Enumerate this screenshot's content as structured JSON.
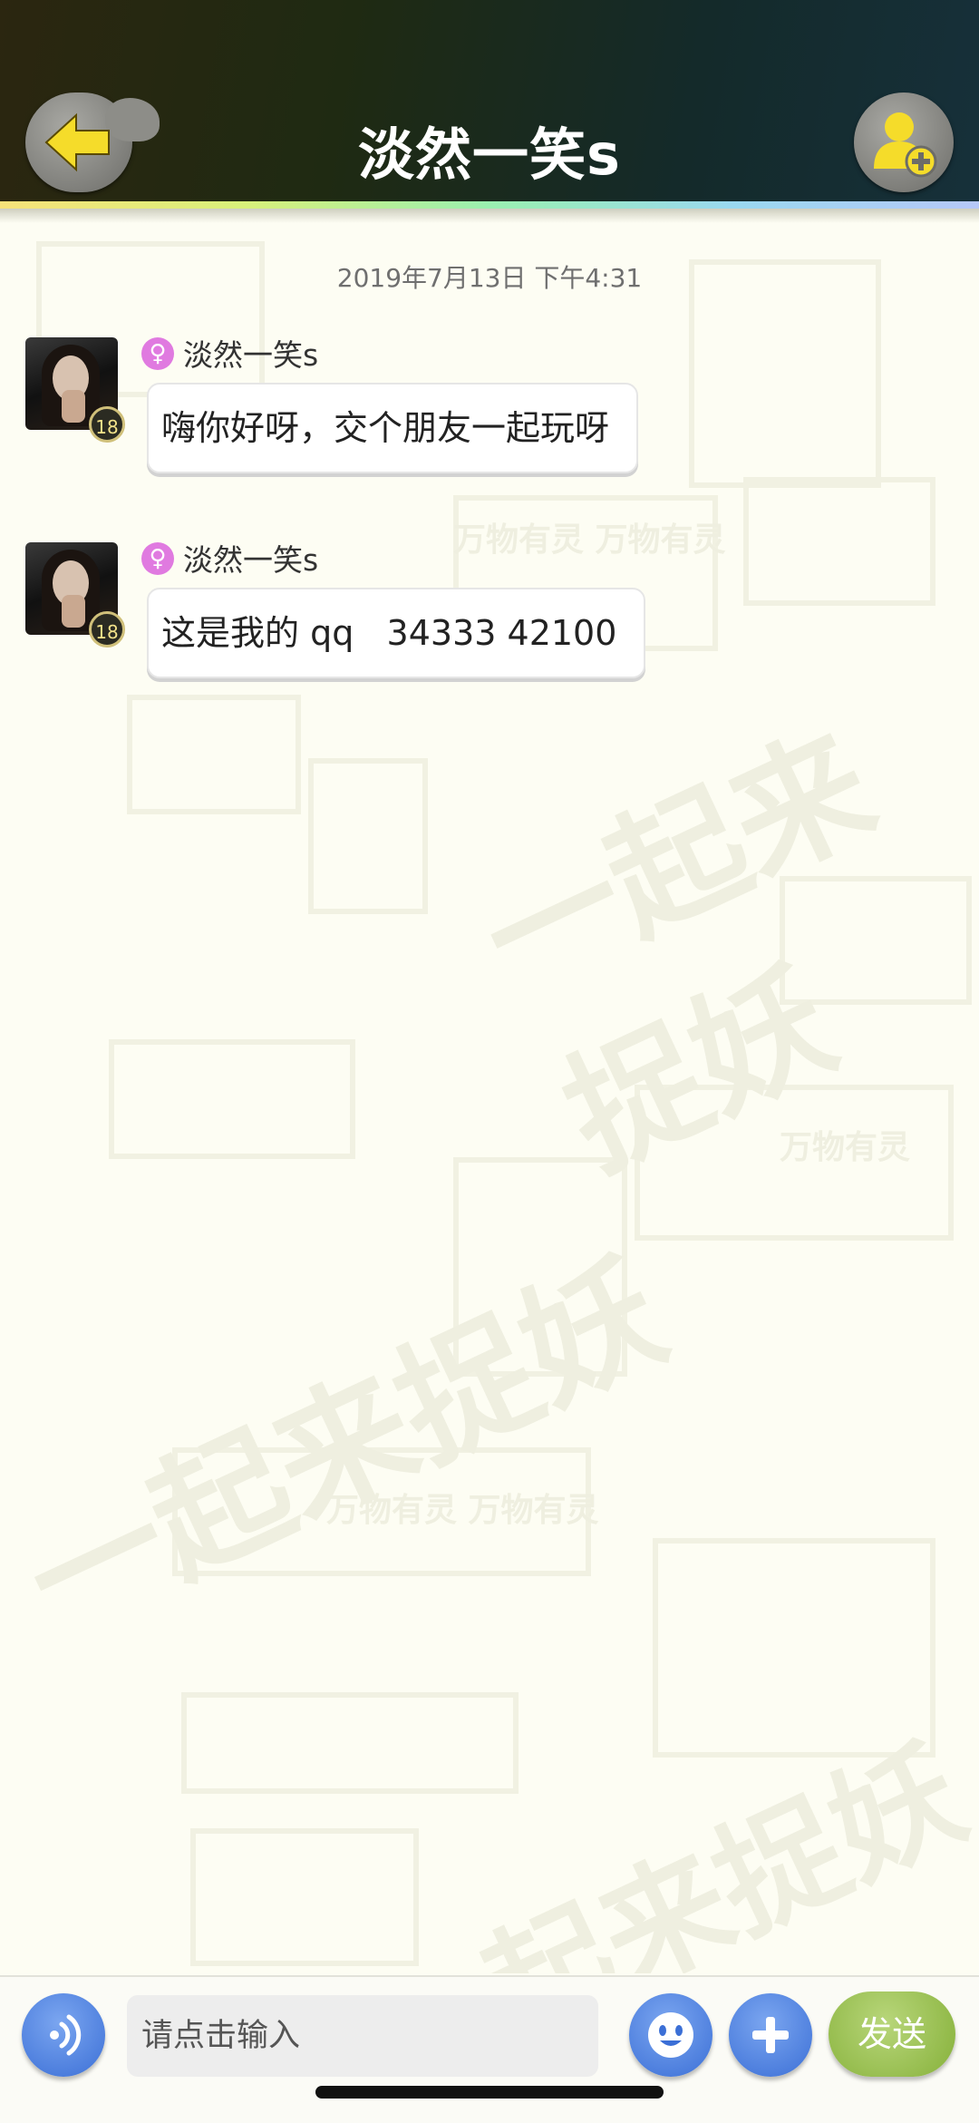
{
  "header": {
    "title": "淡然一笑s",
    "back_icon": "arrow-left-icon",
    "add_friend_icon": "add-user-icon"
  },
  "timestamp": "2019年7月13日 下午4:31",
  "messages": [
    {
      "sender": "淡然一笑s",
      "gender_icon": "♀",
      "level": "18",
      "text": "嗨你好呀，交个朋友一起玩呀"
    },
    {
      "sender": "淡然一笑s",
      "gender_icon": "♀",
      "level": "18",
      "text": "这是我的 qq   34333 42100"
    }
  ],
  "bottom": {
    "input_placeholder": "请点击输入",
    "send_label": "发送"
  },
  "colors": {
    "background": "#fdfdf3",
    "button_blue": "#3b6fd6",
    "send_green": "#86b13a",
    "gender_pink": "#e07ae0"
  }
}
